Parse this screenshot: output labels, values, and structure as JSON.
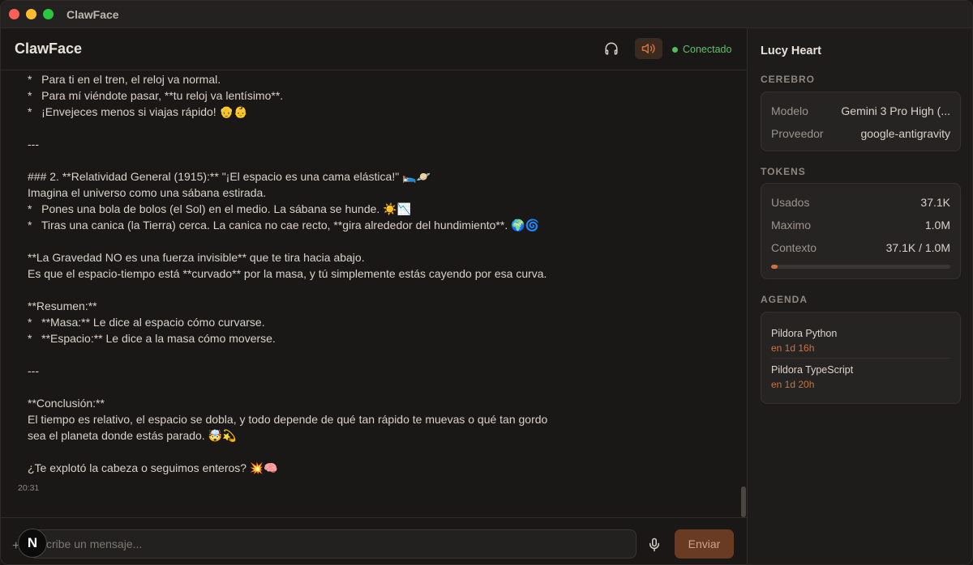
{
  "window": {
    "title": "ClawFace"
  },
  "header": {
    "app_title": "ClawFace",
    "status": "Conectado",
    "colors": {
      "status": "#5cc06a",
      "accent": "#d0703e"
    }
  },
  "messages": {
    "lines": [
      "*   Para ti en el tren, el reloj va normal.",
      "*   Para mí viéndote pasar, **tu reloj va lentísimo**.",
      "*   ¡Envejeces menos si viajas rápido! 👴👶",
      "",
      "---",
      "",
      "### 2. **Relatividad General (1915):** \"¡El espacio es una cama elástica!\" 🛌🪐",
      "Imagina el universo como una sábana estirada.",
      "*   Pones una bola de bolos (el Sol) en el medio. La sábana se hunde. ☀️📉",
      "*   Tiras una canica (la Tierra) cerca. La canica no cae recto, **gira alrededor del hundimiento**. 🌍🌀",
      "",
      "**La Gravedad NO es una fuerza invisible** que te tira hacia abajo.",
      "Es que el espacio-tiempo está **curvado** por la masa, y tú simplemente estás cayendo por esa curva.",
      "",
      "**Resumen:**",
      "*   **Masa:** Le dice al espacio cómo curvarse.",
      "*   **Espacio:** Le dice a la masa cómo moverse.",
      "",
      "---",
      "",
      "**Conclusión:**",
      "El tiempo es relativo, el espacio se dobla, y todo depende de qué tan rápido te muevas o qué tan gordo",
      "sea el planeta donde estás parado. 🤯💫",
      "",
      "¿Te explotó la cabeza o seguimos enteros? 💥🧠"
    ],
    "timestamp": "20:31"
  },
  "composer": {
    "placeholder": "scribe un mensaje...",
    "plus": "+",
    "badge": "N",
    "send_label": "Enviar"
  },
  "sidebar": {
    "name": "Lucy Heart",
    "cerebro": {
      "label": "CEREBRO",
      "model_key": "Modelo",
      "model_value": "Gemini 3 Pro High (...",
      "provider_key": "Proveedor",
      "provider_value": "google-antigravity"
    },
    "tokens": {
      "label": "TOKENS",
      "used_key": "Usados",
      "used_value": "37.1K",
      "max_key": "Maximo",
      "max_value": "1.0M",
      "context_key": "Contexto",
      "context_value": "37.1K / 1.0M",
      "context_fraction": 0.037
    },
    "agenda": {
      "label": "AGENDA",
      "items": [
        {
          "title": "Pildora Python",
          "time": "en 1d 16h"
        },
        {
          "title": "Pildora TypeScript",
          "time": "en 1d 20h"
        }
      ]
    }
  }
}
